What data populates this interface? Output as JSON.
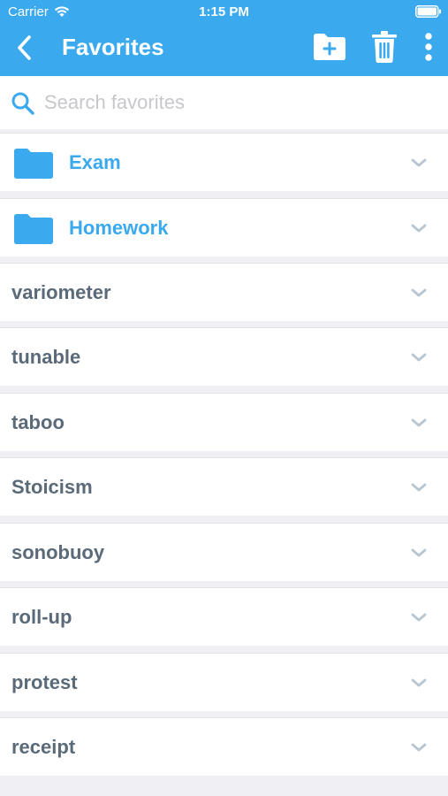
{
  "status_bar": {
    "carrier": "Carrier",
    "time": "1:15 PM",
    "icons": [
      "wifi-icon",
      "battery-icon"
    ]
  },
  "nav": {
    "title": "Favorites",
    "back_icon": "chevron-left-icon",
    "actions": [
      "new-folder-icon",
      "trash-icon",
      "more-vertical-icon"
    ]
  },
  "search": {
    "placeholder": "Search favorites",
    "value": "",
    "icon": "search-icon"
  },
  "folders": [
    {
      "label": "Exam",
      "icon": "folder-icon"
    },
    {
      "label": "Homework",
      "icon": "folder-icon"
    }
  ],
  "words": [
    {
      "label": "variometer"
    },
    {
      "label": "tunable"
    },
    {
      "label": "taboo"
    },
    {
      "label": "Stoicism"
    },
    {
      "label": "sonobuoy"
    },
    {
      "label": "roll-up"
    },
    {
      "label": "protest"
    },
    {
      "label": "receipt"
    }
  ],
  "colors": {
    "accent": "#3aa9ee",
    "background": "#efeff4",
    "text": "#5a6a78",
    "chevron": "#b8c6d2"
  }
}
